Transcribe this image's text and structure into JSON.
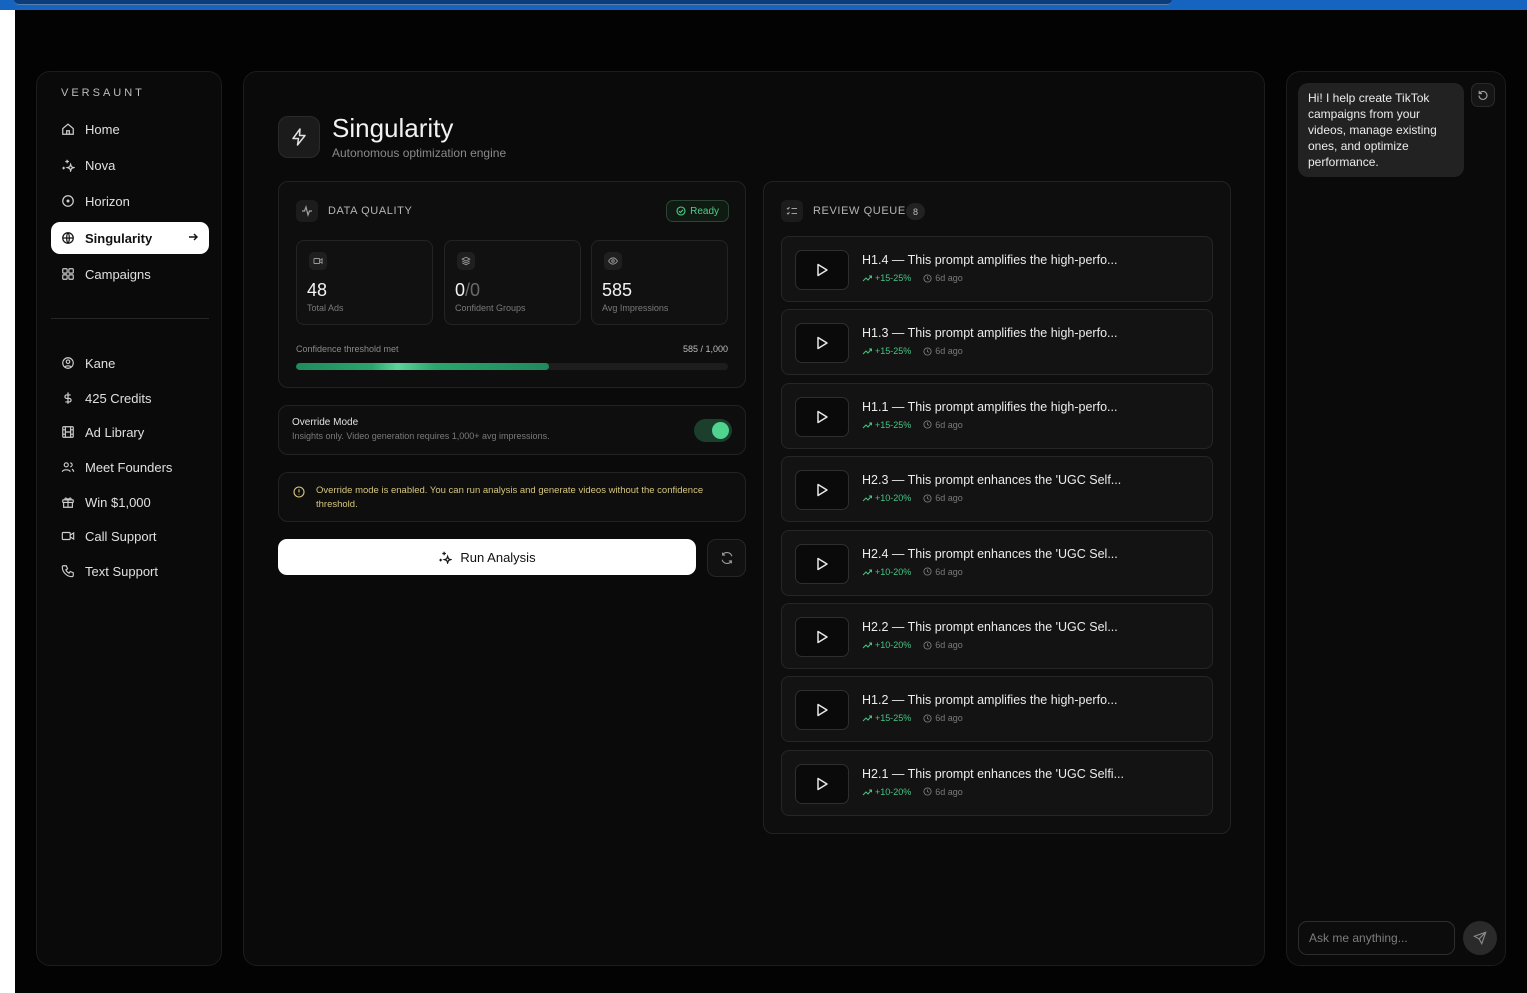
{
  "brand": "VERSAUNT",
  "nav_primary": [
    {
      "label": "Home",
      "icon": "home-icon"
    },
    {
      "label": "Nova",
      "icon": "sparkles-icon"
    },
    {
      "label": "Horizon",
      "icon": "target-icon"
    },
    {
      "label": "Singularity",
      "icon": "globe-icon",
      "active": true
    },
    {
      "label": "Campaigns",
      "icon": "grid-icon"
    }
  ],
  "nav_secondary": [
    {
      "label": "Kane",
      "icon": "user-circle-icon"
    },
    {
      "label": "425 Credits",
      "icon": "dollar-icon"
    },
    {
      "label": "Ad Library",
      "icon": "film-icon"
    },
    {
      "label": "Meet Founders",
      "icon": "users-icon"
    },
    {
      "label": "Win $1,000",
      "icon": "gift-icon"
    },
    {
      "label": "Call Support",
      "icon": "video-icon"
    },
    {
      "label": "Text Support",
      "icon": "phone-icon"
    }
  ],
  "header": {
    "title": "Singularity",
    "subtitle": "Autonomous optimization engine"
  },
  "data_quality": {
    "label": "DATA QUALITY",
    "status": "Ready",
    "stats": [
      {
        "value": "48",
        "label": "Total Ads",
        "icon": "video-icon"
      },
      {
        "value": "0",
        "value_dim": "/0",
        "label": "Confident Groups",
        "icon": "layers-icon"
      },
      {
        "value": "585",
        "label": "Avg Impressions",
        "icon": "eye-icon"
      }
    ],
    "confidence_label": "Confidence threshold met",
    "confidence_value": "585 / 1,000",
    "confidence_fraction": 0.585
  },
  "override": {
    "title": "Override Mode",
    "subtitle": "Insights only. Video generation requires 1,000+ avg impressions.",
    "enabled": true
  },
  "warning": {
    "text": "Override mode is enabled. You can run analysis and generate videos without the confidence threshold."
  },
  "run_button": "Run Analysis",
  "review_queue": {
    "label": "REVIEW QUEUE",
    "count": "8",
    "items": [
      {
        "title": "H1.4 — This prompt amplifies the high-perfo...",
        "gain": "+15-25%",
        "ago": "6d ago"
      },
      {
        "title": "H1.3 — This prompt amplifies the high-perfo...",
        "gain": "+15-25%",
        "ago": "6d ago"
      },
      {
        "title": "H1.1 — This prompt amplifies the high-perfo...",
        "gain": "+15-25%",
        "ago": "6d ago"
      },
      {
        "title": "H2.3 — This prompt enhances the 'UGC Self...",
        "gain": "+10-20%",
        "ago": "6d ago"
      },
      {
        "title": "H2.4 — This prompt enhances the 'UGC Sel...",
        "gain": "+10-20%",
        "ago": "6d ago"
      },
      {
        "title": "H2.2 — This prompt enhances the 'UGC Sel...",
        "gain": "+10-20%",
        "ago": "6d ago"
      },
      {
        "title": "H1.2 — This prompt amplifies the high-perfo...",
        "gain": "+15-25%",
        "ago": "6d ago"
      },
      {
        "title": "H2.1 — This prompt enhances the 'UGC Selfi...",
        "gain": "+10-20%",
        "ago": "6d ago"
      }
    ]
  },
  "chat": {
    "greeting": "Hi! I help create TikTok campaigns from your videos, manage existing ones, and optimize performance.",
    "placeholder": "Ask me anything..."
  },
  "colors": {
    "accent_green": "#4fd38f",
    "warning_text": "#d6c67d",
    "browser_bar": "#1565c0"
  }
}
